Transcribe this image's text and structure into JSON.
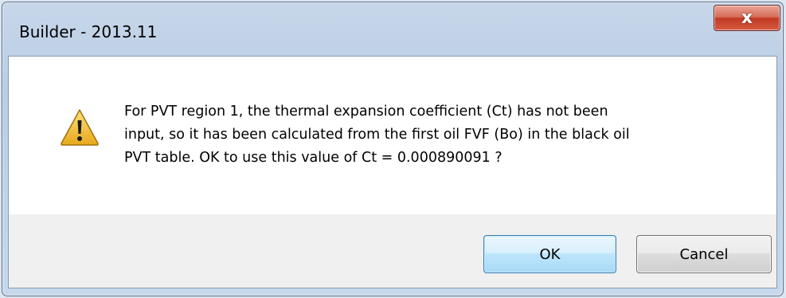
{
  "window": {
    "title": "Builder - 2013.11",
    "close_glyph": "x"
  },
  "message": {
    "icon": "warning-icon",
    "lines": [
      "For PVT region 1, the thermal expansion coefficient (Ct) has not been",
      "input, so it has been calculated from the first oil FVF (Bo) in the black oil",
      "PVT table.  OK to use this value of Ct = 0.000890091 ?"
    ]
  },
  "buttons": {
    "ok_label": "OK",
    "cancel_label": "Cancel"
  },
  "colors": {
    "title_bar": "#b9cde5",
    "close_button": "#c94a34",
    "ok_button_border": "#3c7fb1",
    "warning_fill": "#f2c233"
  }
}
